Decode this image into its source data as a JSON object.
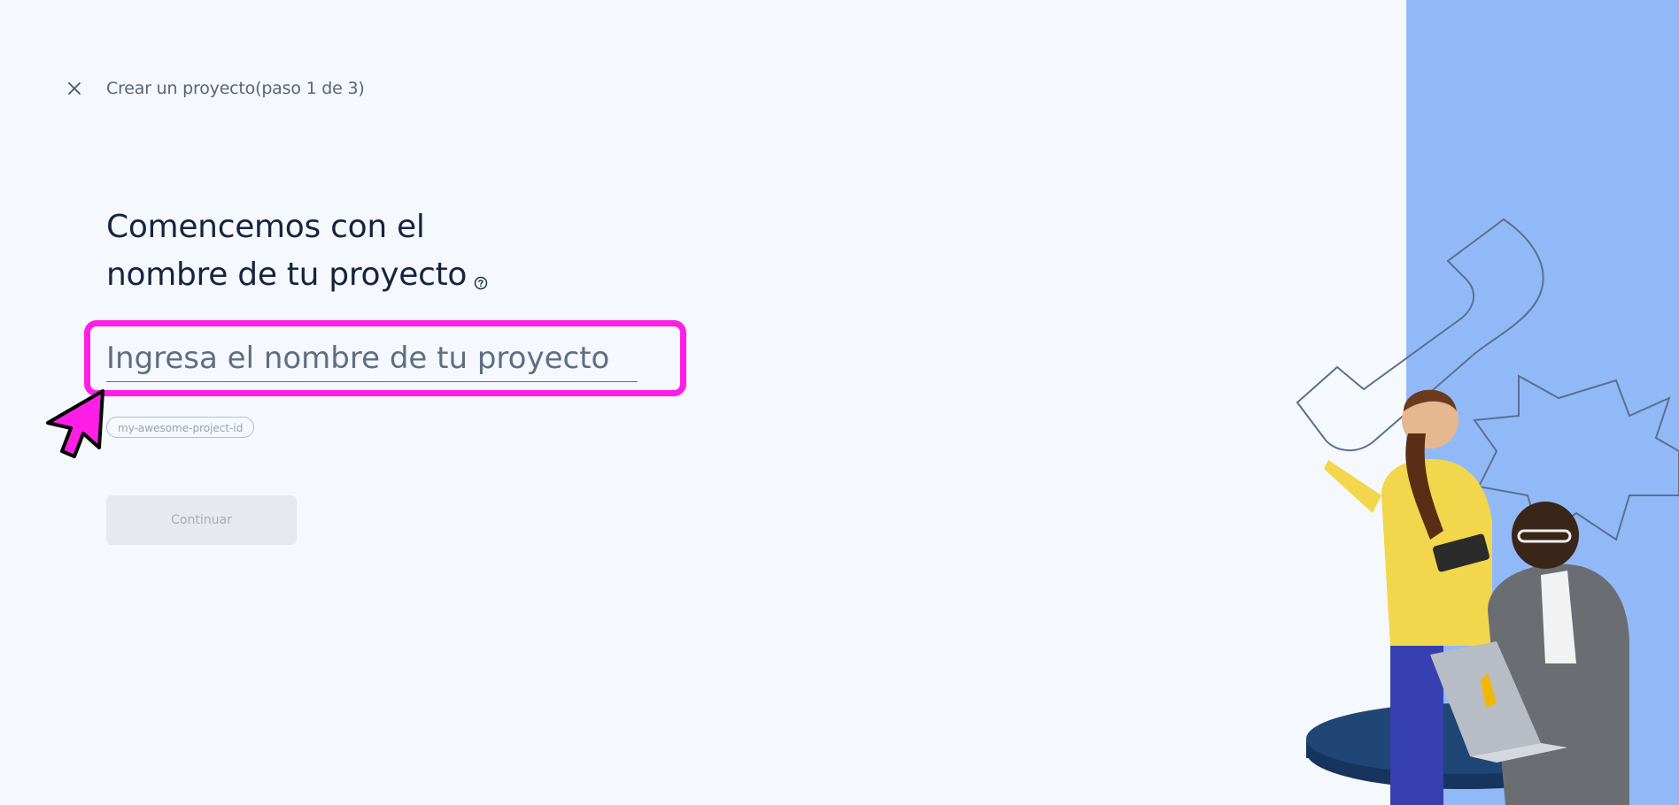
{
  "header": {
    "close_icon": "close-icon",
    "step_title": "Crear un proyecto(paso 1 de 3)"
  },
  "main": {
    "heading_line1": "Comencemos con el",
    "heading_line2": "nombre de tu proyecto",
    "help_icon": "help-circle-icon",
    "project_name_input": {
      "value": "",
      "placeholder": "Ingresa el nombre de tu proyecto"
    },
    "project_id_chip": "my-awesome-project-id",
    "continue_label": "Continuar"
  },
  "colors": {
    "highlight": "#ff1ee5",
    "panel_blue": "#91b9f7",
    "heading": "#16243f"
  }
}
